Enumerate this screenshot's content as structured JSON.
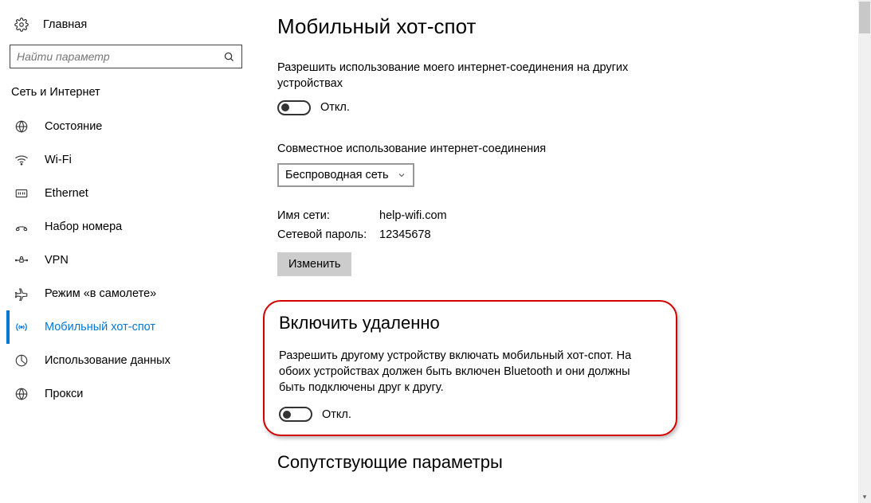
{
  "sidebar": {
    "home": "Главная",
    "search_placeholder": "Найти параметр",
    "category": "Сеть и Интернет",
    "items": [
      {
        "label": "Состояние"
      },
      {
        "label": "Wi-Fi"
      },
      {
        "label": "Ethernet"
      },
      {
        "label": "Набор номера"
      },
      {
        "label": "VPN"
      },
      {
        "label": "Режим «в самолете»"
      },
      {
        "label": "Мобильный хот-спот"
      },
      {
        "label": "Использование данных"
      },
      {
        "label": "Прокси"
      }
    ]
  },
  "main": {
    "title": "Мобильный хот-спот",
    "share_desc": "Разрешить использование моего интернет-соединения на других устройствах",
    "toggle_off": "Откл.",
    "share_from_label": "Совместное использование интернет-соединения",
    "share_from_value": "Беспроводная сеть",
    "network_name_label": "Имя сети:",
    "network_name_value": "help-wifi.com",
    "network_pass_label": "Сетевой пароль:",
    "network_pass_value": "12345678",
    "edit_btn": "Изменить",
    "remote": {
      "title": "Включить удаленно",
      "desc": "Разрешить другому устройству включать мобильный хот-спот. На обоих устройствах должен быть включен Bluetooth и они должны быть подключены друг к другу."
    },
    "related_title": "Сопутствующие параметры"
  }
}
